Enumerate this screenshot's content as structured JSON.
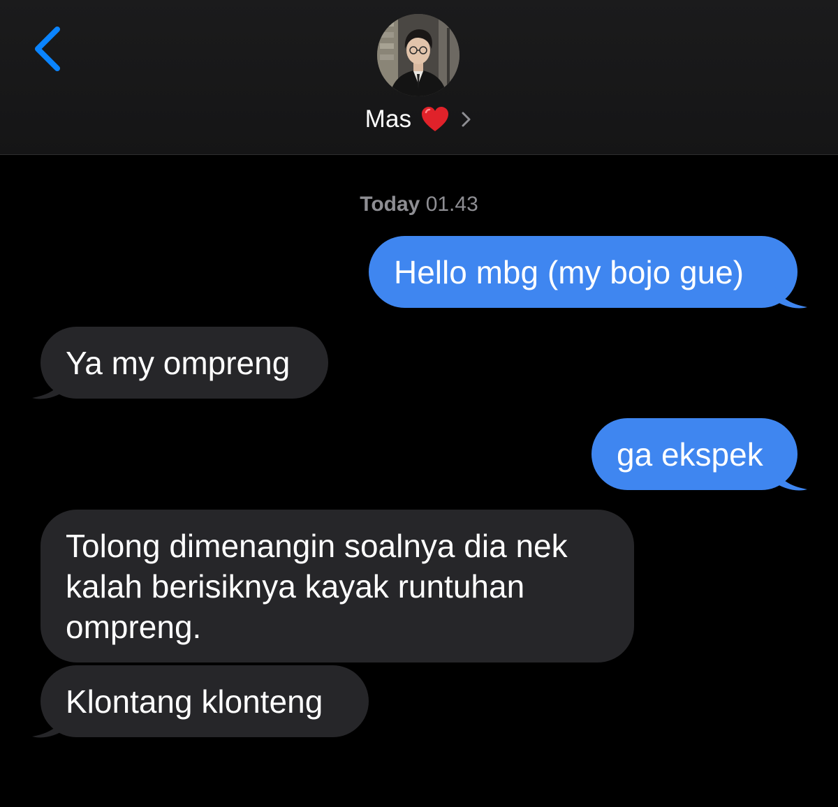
{
  "header": {
    "contact_name": "Mas",
    "heart_emoji": "❤️",
    "back_icon": "chevron-left-icon",
    "details_icon": "chevron-right-icon",
    "accent_color": "#0a84ff"
  },
  "conversation": {
    "timestamp_day": "Today",
    "timestamp_time": "01.43",
    "messages": [
      {
        "direction": "sent",
        "text": "Hello mbg (my bojo gue)"
      },
      {
        "direction": "received",
        "text": "Ya my ompreng"
      },
      {
        "direction": "sent",
        "text": "ga ekspek"
      },
      {
        "direction": "received",
        "text": "Tolong dimenangin soalnya dia nek kalah berisiknya kayak runtuhan ompreng."
      },
      {
        "direction": "received",
        "text": "Klontang klonteng"
      }
    ]
  },
  "colors": {
    "sent_bubble": "#3f86f0",
    "received_bubble": "#262629",
    "background": "#000000",
    "header_background": "#1b1b1c",
    "timestamp": "#8e8e93"
  }
}
